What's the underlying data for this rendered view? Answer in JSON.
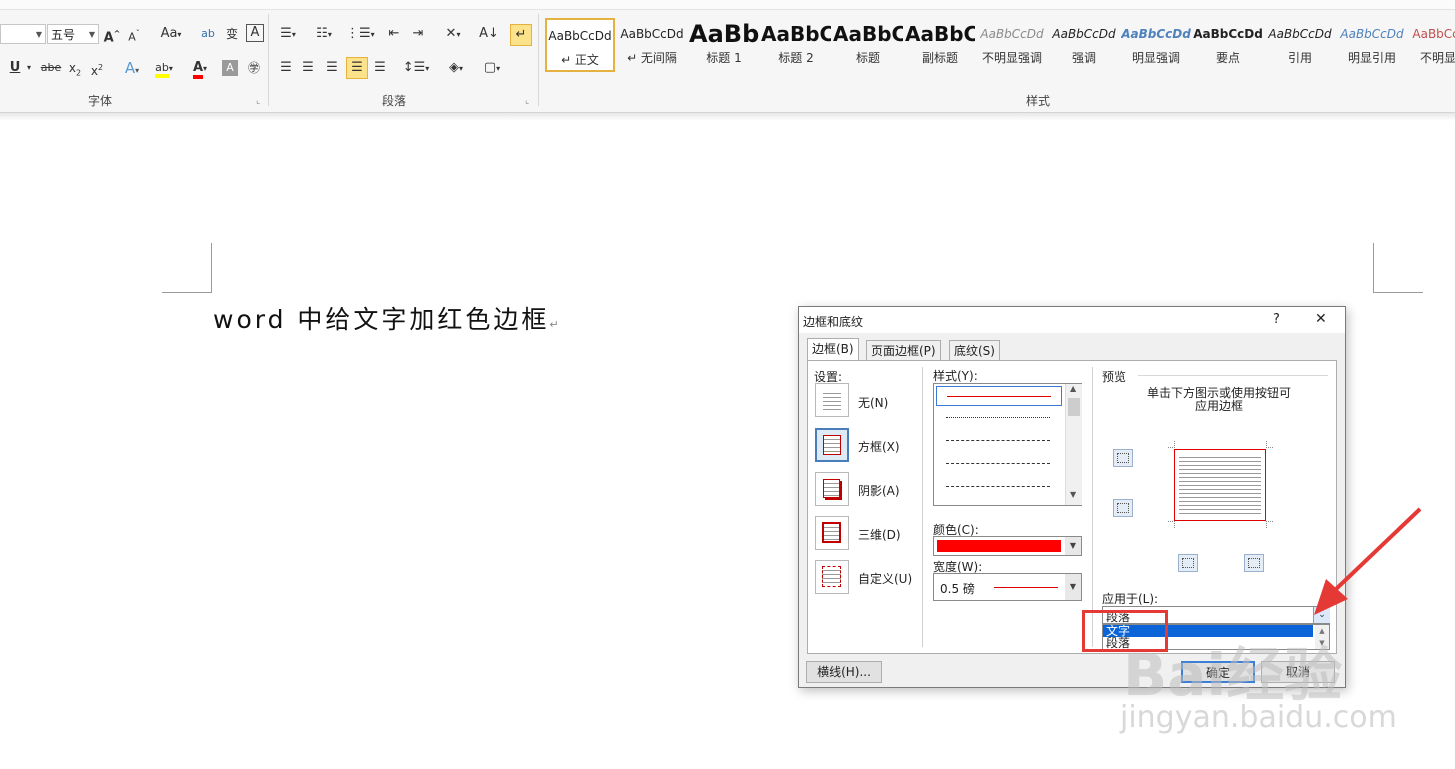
{
  "ribbon": {
    "font_group_label": "字体",
    "paragraph_group_label": "段落",
    "styles_group_label": "样式",
    "font_size_value": "五号",
    "font_buttons": [
      "A˄",
      "A˅",
      "Aa",
      "abc",
      "wén",
      "A"
    ],
    "format_buttons": [
      "U",
      "abc",
      "x₂",
      "x²",
      "A",
      "ab",
      "A",
      "A",
      "字"
    ],
    "styles": [
      {
        "sample": "AaBbCcDd",
        "name": "↵ 正文",
        "size": 12,
        "bold": false,
        "color": "#222222",
        "italic": false
      },
      {
        "sample": "AaBbCcDd",
        "name": "↵ 无间隔",
        "size": 12,
        "bold": false,
        "color": "#222222",
        "italic": false
      },
      {
        "sample": "AaBb",
        "name": "标题 1",
        "size": 24,
        "bold": true,
        "color": "#111111",
        "italic": false
      },
      {
        "sample": "AaBbC",
        "name": "标题 2",
        "size": 20,
        "bold": true,
        "color": "#111111",
        "italic": false
      },
      {
        "sample": "AaBbC",
        "name": "标题",
        "size": 20,
        "bold": true,
        "color": "#111111",
        "italic": false
      },
      {
        "sample": "AaBbC",
        "name": "副标题",
        "size": 20,
        "bold": true,
        "color": "#111111",
        "italic": false
      },
      {
        "sample": "AaBbCcDd",
        "name": "不明显强调",
        "size": 12,
        "bold": false,
        "color": "#8a8a8a",
        "italic": true
      },
      {
        "sample": "AaBbCcDd",
        "name": "强调",
        "size": 12,
        "bold": false,
        "color": "#222222",
        "italic": true
      },
      {
        "sample": "AaBbCcDd",
        "name": "明显强调",
        "size": 12,
        "bold": true,
        "color": "#4f81bd",
        "italic": true
      },
      {
        "sample": "AaBbCcDd",
        "name": "要点",
        "size": 12,
        "bold": true,
        "color": "#222222",
        "italic": false
      },
      {
        "sample": "AaBbCcDd",
        "name": "引用",
        "size": 12,
        "bold": false,
        "color": "#222222",
        "italic": true
      },
      {
        "sample": "AaBbCcDd",
        "name": "明显引用",
        "size": 12,
        "bold": false,
        "color": "#4f81bd",
        "italic": true
      },
      {
        "sample": "AaBbCcDd",
        "name": "不明显参",
        "size": 12,
        "bold": false,
        "color": "#c0504d",
        "italic": false
      }
    ]
  },
  "document": {
    "text": "word 中给文字加红色边框",
    "pilcrow": "↵"
  },
  "dialog": {
    "title": "边框和底纹",
    "help": "?",
    "close": "✕",
    "tabs": [
      "边框(B)",
      "页面边框(P)",
      "底纹(S)"
    ],
    "settings_label": "设置:",
    "settings": [
      "无(N)",
      "方框(X)",
      "阴影(A)",
      "三维(D)",
      "自定义(U)"
    ],
    "style_label": "样式(Y):",
    "color_label": "颜色(C):",
    "color_value": "#ff0000",
    "width_label": "宽度(W):",
    "width_value": "0.5 磅",
    "preview_label": "预览",
    "preview_hint_1": "单击下方图示或使用按钮可",
    "preview_hint_2": "应用边框",
    "apply_label": "应用于(L):",
    "apply_value": "段落",
    "apply_options": [
      "文字",
      "段落"
    ],
    "horizontal_line_button": "横线(H)...",
    "ok_button": "确定",
    "cancel_button": "取消"
  },
  "colors": {
    "highlight_red": "#e53935",
    "selection_blue": "#0a64d8",
    "ribbon_accent": "#e6b23f"
  },
  "watermark": {
    "brand": "Bai经验",
    "url": "jingyan.baidu.com"
  }
}
